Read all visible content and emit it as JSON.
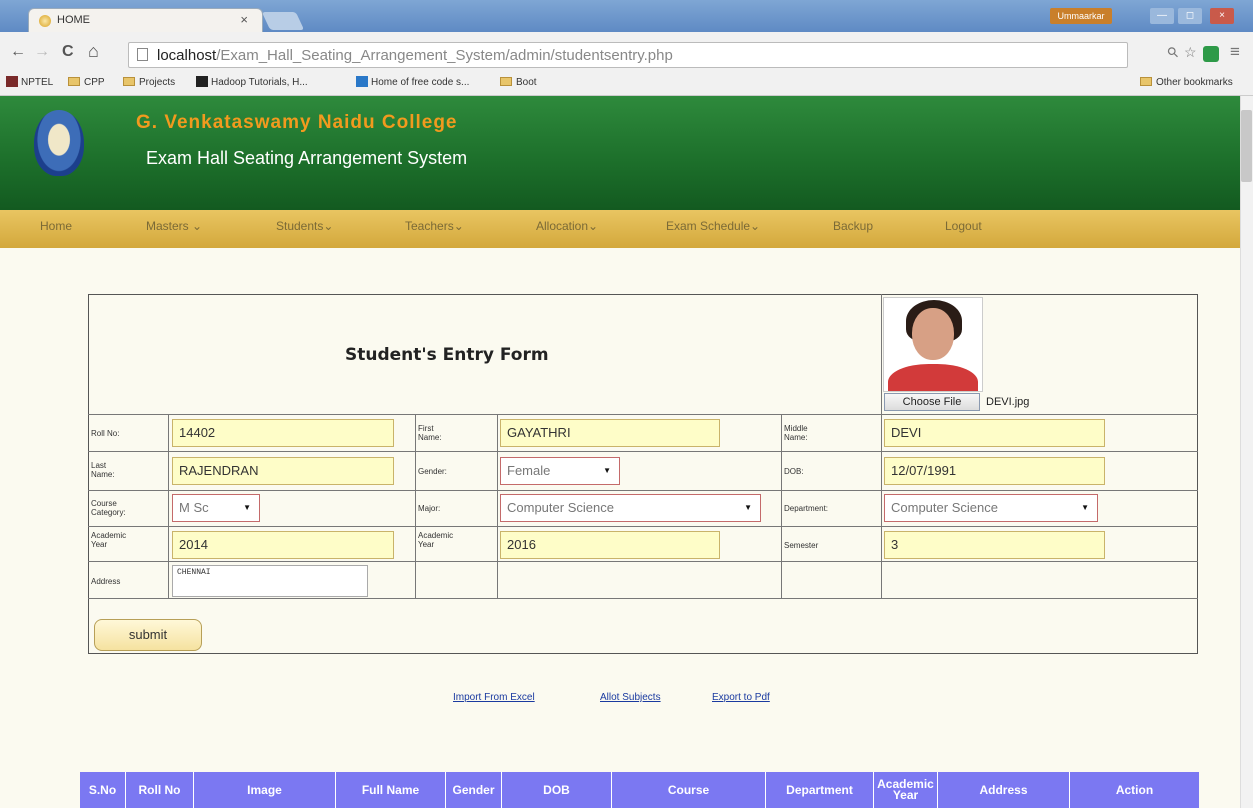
{
  "browser": {
    "tab_title": "HOME",
    "tab_close": "×",
    "window_user": "Ummaarkar",
    "window_buttons": [
      "—",
      "◻",
      "×"
    ],
    "url_host": "localhost",
    "url_path": "/Exam_Hall_Seating_Arrangement_System/admin/studentsentry.php",
    "nav": {
      "back": "←",
      "forward": "→",
      "reload": "C",
      "home": "⌂"
    },
    "toolbar_icons": {
      "zoom": "⚲",
      "star": "☆",
      "menu": "≡"
    },
    "bookmarks": [
      "NPTEL",
      "CPP",
      "Projects",
      "Hadoop Tutorials, H...",
      "Home of free code s...",
      "Boot"
    ],
    "other_bookmarks": "Other bookmarks"
  },
  "header": {
    "college": "G. Venkataswamy Naidu College",
    "system": "Exam Hall Seating Arrangement System"
  },
  "menu": [
    "Home",
    "Masters ⌄",
    "Students⌄",
    "Teachers⌄",
    "Allocation⌄",
    "Exam Schedule⌄",
    "Backup",
    "Logout"
  ],
  "form": {
    "title": "Student's Entry Form",
    "choose_file": "Choose File",
    "file_name": "DEVI.jpg",
    "labels": {
      "roll_no": "Roll No:",
      "first_name": "First Name:",
      "middle_name": "Middle Name:",
      "last_name": "Last Name:",
      "gender": "Gender:",
      "dob": "DOB:",
      "course_category": "Course Category:",
      "major": "Major:",
      "department": "Department:",
      "academic_year_from": "Academic Year",
      "academic_year_to": "Academic Year",
      "semester": "Semester",
      "address": "Address"
    },
    "values": {
      "roll_no": "14402",
      "first_name": "GAYATHRI",
      "middle_name": "DEVI",
      "last_name": "RAJENDRAN",
      "gender": "Female",
      "dob": "12/07/1991",
      "course_category": "M Sc",
      "major": "Computer Science",
      "department": "Computer Science",
      "academic_year_from": "2014",
      "academic_year_to": "2016",
      "semester": "3",
      "address": "CHENNAI"
    },
    "submit": "submit"
  },
  "links": [
    "Import From Excel",
    "Allot Subjects",
    "Export to Pdf"
  ],
  "table": {
    "headers": [
      "S.No",
      "Roll No",
      "Image",
      "Full Name",
      "Gender",
      "DOB",
      "Course",
      "Department",
      "Academic Year",
      "Address",
      "Action"
    ]
  },
  "colors": {
    "header_green": "#1c6e2a",
    "college_orange": "#f29a1e",
    "menu_gold": "#d9b24a",
    "table_header": "#7b78f2",
    "input_yellow": "#fefdc8"
  }
}
